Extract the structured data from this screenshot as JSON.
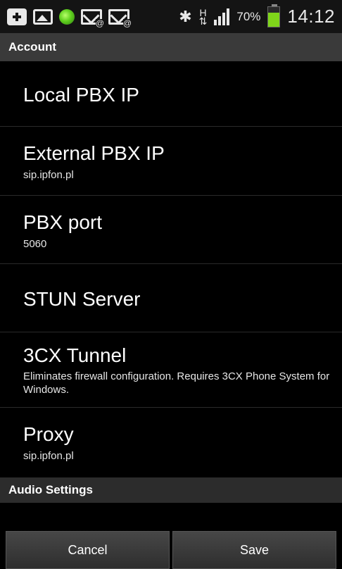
{
  "status_bar": {
    "icons": [
      "plus-icon",
      "image-icon",
      "green-dot-icon",
      "mail-icon",
      "mail-icon",
      "bluetooth-icon",
      "hspa-data-icon",
      "signal-icon",
      "battery-icon"
    ],
    "network": "H",
    "battery_percent": "70%",
    "battery_level": 0.7,
    "time": "14:12",
    "battery_color": "#7fd51a"
  },
  "account_header": "Account",
  "items": [
    {
      "title": "Local PBX IP",
      "summary": ""
    },
    {
      "title": "External PBX IP",
      "summary": "sip.ipfon.pl"
    },
    {
      "title": "PBX port",
      "summary": "5060"
    },
    {
      "title": "STUN Server",
      "summary": ""
    },
    {
      "title": "3CX Tunnel",
      "summary": "Eliminates firewall configuration. Requires 3CX Phone System for Windows."
    },
    {
      "title": "Proxy",
      "summary": "sip.ipfon.pl"
    }
  ],
  "audio_header": "Audio Settings",
  "buttons": {
    "cancel": "Cancel",
    "save": "Save"
  }
}
